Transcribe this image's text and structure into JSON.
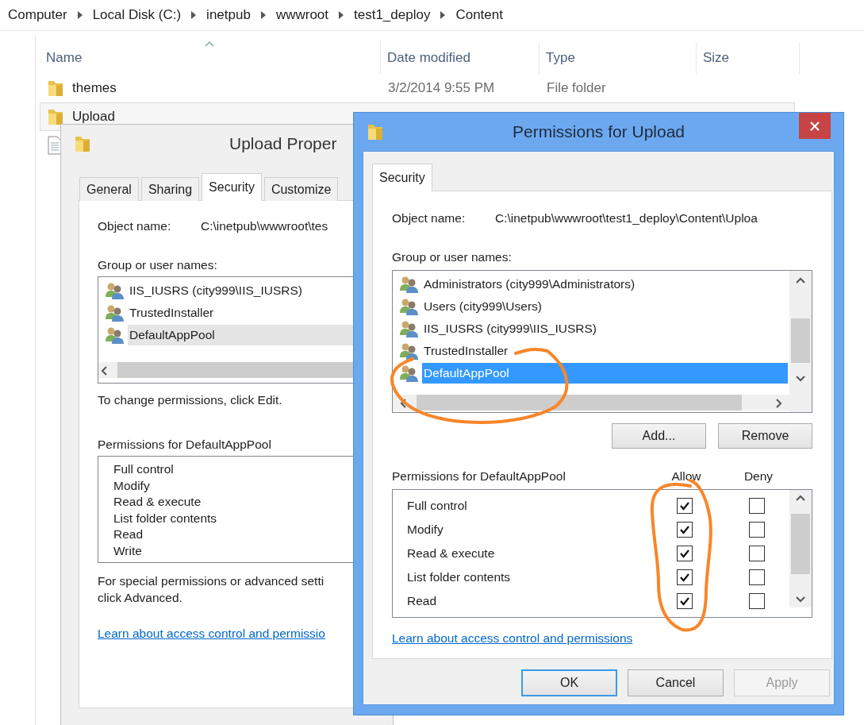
{
  "explorer": {
    "breadcrumb": [
      "Computer",
      "Local Disk (C:)",
      "inetpub",
      "wwwroot",
      "test1_deploy",
      "Content"
    ],
    "columns": [
      "Name",
      "Date modified",
      "Type",
      "Size"
    ],
    "rows": [
      {
        "kind": "folder",
        "name": "themes",
        "date": "3/2/2014 9:55 PM",
        "type": "File folder",
        "selected": false
      },
      {
        "kind": "folder",
        "name": "Upload",
        "selected": true
      },
      {
        "kind": "file",
        "selected": false
      }
    ]
  },
  "properties_dialog": {
    "title": "Upload Proper",
    "tabs": [
      {
        "label": "General",
        "selected": false
      },
      {
        "label": "Sharing",
        "selected": false
      },
      {
        "label": "Security",
        "selected": true
      },
      {
        "label": "Customize",
        "selected": false
      }
    ],
    "object_name_label": "Object name:",
    "object_name": "C:\\inetpub\\wwwroot\\tes",
    "group_label": "Group or user names:",
    "users": [
      {
        "name": "IIS_IUSRS (city999\\IIS_IUSRS)",
        "selected": false
      },
      {
        "name": "TrustedInstaller",
        "selected": false
      },
      {
        "name": "DefaultAppPool",
        "selected": true
      }
    ],
    "hint": "To change permissions, click Edit.",
    "permissions_label": "Permissions for DefaultAppPool",
    "permissions": [
      "Full control",
      "Modify",
      "Read & execute",
      "List folder contents",
      "Read",
      "Write"
    ],
    "advanced_note": [
      "For special permissions or advanced setti",
      "click Advanced."
    ],
    "link": "Learn about access control and permissio"
  },
  "permissions_dialog": {
    "title": "Permissions for Upload",
    "tabs": [
      {
        "label": "Security",
        "selected": true
      }
    ],
    "object_name_label": "Object name:",
    "object_name": "C:\\inetpub\\wwwroot\\test1_deploy\\Content\\Uploa",
    "group_label": "Group or user names:",
    "users": [
      {
        "name": "Administrators (city999\\Administrators)",
        "selected": false
      },
      {
        "name": "Users (city999\\Users)",
        "selected": false
      },
      {
        "name": "IIS_IUSRS (city999\\IIS_IUSRS)",
        "selected": false
      },
      {
        "name": "TrustedInstaller",
        "selected": false
      },
      {
        "name": "DefaultAppPool",
        "selected": true
      }
    ],
    "user_buttons": [
      "Add...",
      "Remove"
    ],
    "permissions_label": "Permissions for DefaultAppPool",
    "allow_label": "Allow",
    "deny_label": "Deny",
    "permissions": [
      {
        "name": "Full control",
        "allow": true,
        "deny": false
      },
      {
        "name": "Modify",
        "allow": true,
        "deny": false
      },
      {
        "name": "Read & execute",
        "allow": true,
        "deny": false
      },
      {
        "name": "List folder contents",
        "allow": true,
        "deny": false
      },
      {
        "name": "Read",
        "allow": true,
        "deny": false
      }
    ],
    "link": "Learn about access control and permissions",
    "buttons": [
      {
        "label": "OK",
        "default": true,
        "disabled": false
      },
      {
        "label": "Cancel",
        "default": false,
        "disabled": false
      },
      {
        "label": "Apply",
        "default": false,
        "disabled": true
      }
    ]
  }
}
